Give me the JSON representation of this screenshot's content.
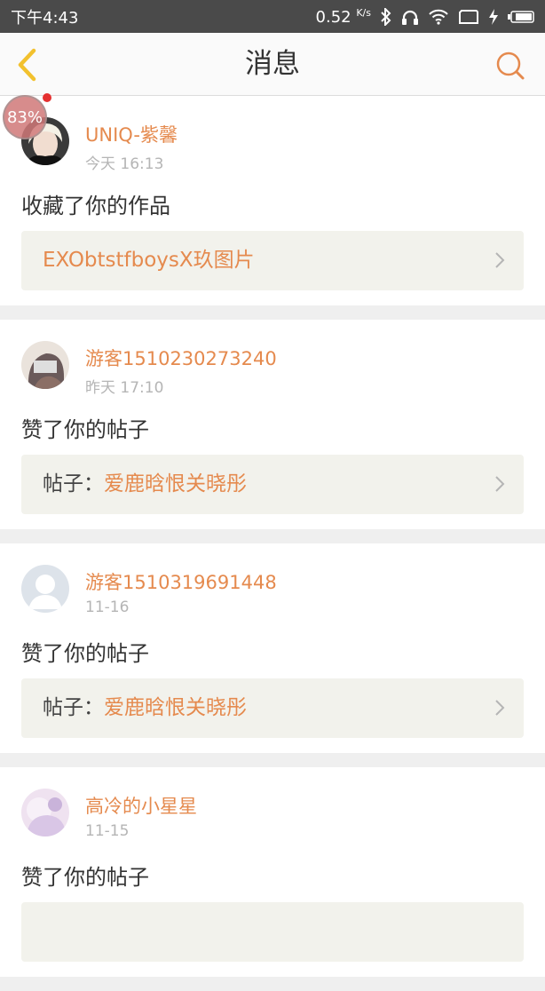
{
  "status_bar": {
    "time": "下午4:43",
    "net_speed": "0.52",
    "net_unit": "K/s"
  },
  "navbar": {
    "title": "消息",
    "back_icon": "chevron-left-icon",
    "search_icon": "search-icon"
  },
  "overlay": {
    "battery_bubble": "83%"
  },
  "colors": {
    "accent": "#e58a4e",
    "back_arrow": "#f2c12e"
  },
  "messages": [
    {
      "name": "UNIQ-紫馨",
      "time": "今天 16:13",
      "action": "收藏了你的作品",
      "link_prefix": "",
      "link_target": "EXObtstfboysX玖图片"
    },
    {
      "name": "游客1510230273240",
      "time": "昨天 17:10",
      "action": "赞了你的帖子",
      "link_prefix": "帖子：",
      "link_target": "爱鹿晗恨关晓彤"
    },
    {
      "name": "游客1510319691448",
      "time": "11-16",
      "action": "赞了你的帖子",
      "link_prefix": "帖子：",
      "link_target": "爱鹿晗恨关晓彤"
    },
    {
      "name": "高冷的小星星",
      "time": "11-15",
      "action": "赞了你的帖子",
      "link_prefix": "",
      "link_target": ""
    }
  ]
}
